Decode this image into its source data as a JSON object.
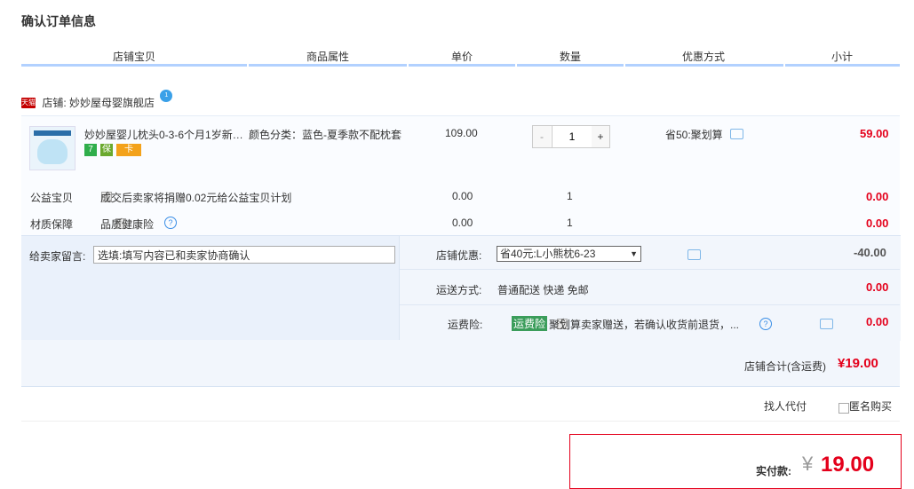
{
  "page": {
    "title": "确认订单信息"
  },
  "columns": [
    "店铺宝贝",
    "商品属性",
    "单价",
    "数量",
    "优惠方式",
    "小计"
  ],
  "shop": {
    "badge": "天猫",
    "name": "店铺: 妙妙屋母婴旗舰店",
    "chat_badge": "1"
  },
  "item": {
    "name": "妙妙屋婴儿枕头0-3-6个月1岁新…",
    "attribute": "颜色分类：蓝色-夏季款不配枕套",
    "price": "109.00",
    "quantity": "1",
    "qty_minus": "-",
    "qty_plus": "+",
    "discount": "省50:聚划算",
    "subtotal": "59.00",
    "service_badges": [
      "7",
      "保",
      "卡"
    ]
  },
  "charity": {
    "label": "公益宝贝",
    "text": "成交后卖家将捐赠0.02元给公益宝贝计划",
    "price": "0.00",
    "qty": "1",
    "subtotal": "0.00"
  },
  "quality": {
    "label": "材质保障",
    "text": "品质健康险",
    "price": "0.00",
    "qty": "1",
    "subtotal": "0.00"
  },
  "message": {
    "label": "给卖家留言:",
    "placeholder": "选填:填写内容已和卖家协商确认"
  },
  "shop_discount": {
    "label": "店铺优惠:",
    "selected": "省40元:L小熊枕6-23",
    "amount": "-40.00"
  },
  "shipping": {
    "label": "运送方式:",
    "value": "普通配送 快递 免邮",
    "amount": "0.00"
  },
  "insurance": {
    "label": "运费险:",
    "tag": "运费险",
    "text": "聚划算卖家赠送，若确认收货前退货，...",
    "amount": "0.00"
  },
  "shop_total": {
    "label": "店铺合计(含运费)",
    "value": "¥19.00"
  },
  "options": {
    "proxy_pay": "找人代付",
    "anonymous": "匿名购买"
  },
  "payment": {
    "label": "实付款:",
    "currency": "¥",
    "amount": "19.00"
  },
  "colors": {
    "accent": "#e4001b",
    "header_line": "#b2d1ff",
    "panel": "#eaf1fb"
  }
}
